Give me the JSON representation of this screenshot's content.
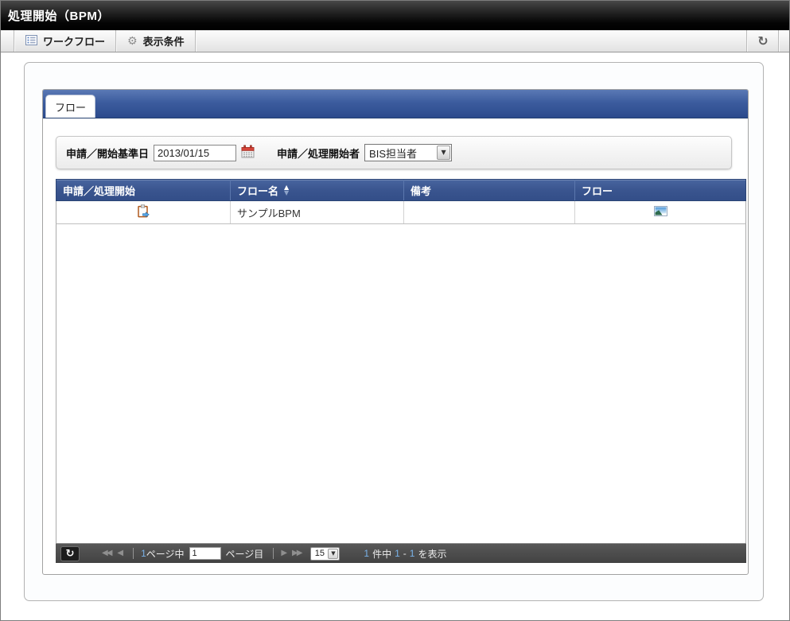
{
  "title_bar": {
    "title": "処理開始（BPM）"
  },
  "toolbar": {
    "workflow_label": "ワークフロー",
    "display_conditions_label": "表示条件",
    "refresh_icon": "refresh-icon",
    "workflow_icon": "list-form-icon",
    "display_conditions_icon": "gear-icon"
  },
  "tabs": {
    "flow_tab_label": "フロー"
  },
  "search": {
    "date_label": "申請／開始基準日",
    "date_value": "2013/01/15",
    "calendar_icon": "calendar-icon",
    "starter_label": "申請／処理開始者",
    "starter_value": "BIS担当者",
    "starter_dropdown_icon": "chevron-down-icon"
  },
  "table": {
    "headers": [
      "申請／処理開始",
      "フロー名",
      "備考",
      "フロー"
    ],
    "sort_column": "フロー名",
    "sort_direction": "asc",
    "sort_icons": {
      "asc": "triangle-up-icon",
      "desc": "triangle-down-icon"
    },
    "rows": [
      {
        "start_icon": "clipboard-start-icon",
        "flow_name": "サンプルBPM",
        "remarks": "",
        "flow_icon": "flow-image-icon"
      }
    ]
  },
  "pagination": {
    "refresh_icon": "refresh-icon",
    "first_icon": "double-left-arrow-icon",
    "prev_icon": "left-arrow-icon",
    "next_icon": "right-arrow-icon",
    "last_icon": "double-right-arrow-icon",
    "total_pages": "1",
    "pages_middle_label": "ページ中",
    "current_page": "1",
    "page_suffix_label": "ページ目",
    "per_page": "15",
    "record_total": "1",
    "record_unit_label": "件中",
    "record_from": "1",
    "record_range_sep": "-",
    "record_to": "1",
    "record_suffix_label": "を表示"
  },
  "colors": {
    "tab_bar_blue": "#2b4a8c",
    "table_header_blue": "#35508a",
    "pagination_bg": "#4a4a4a",
    "accent_number_blue": "#79b2e8",
    "calendar_red": "#d9453a",
    "clipboard_brown": "#b05a1e"
  }
}
